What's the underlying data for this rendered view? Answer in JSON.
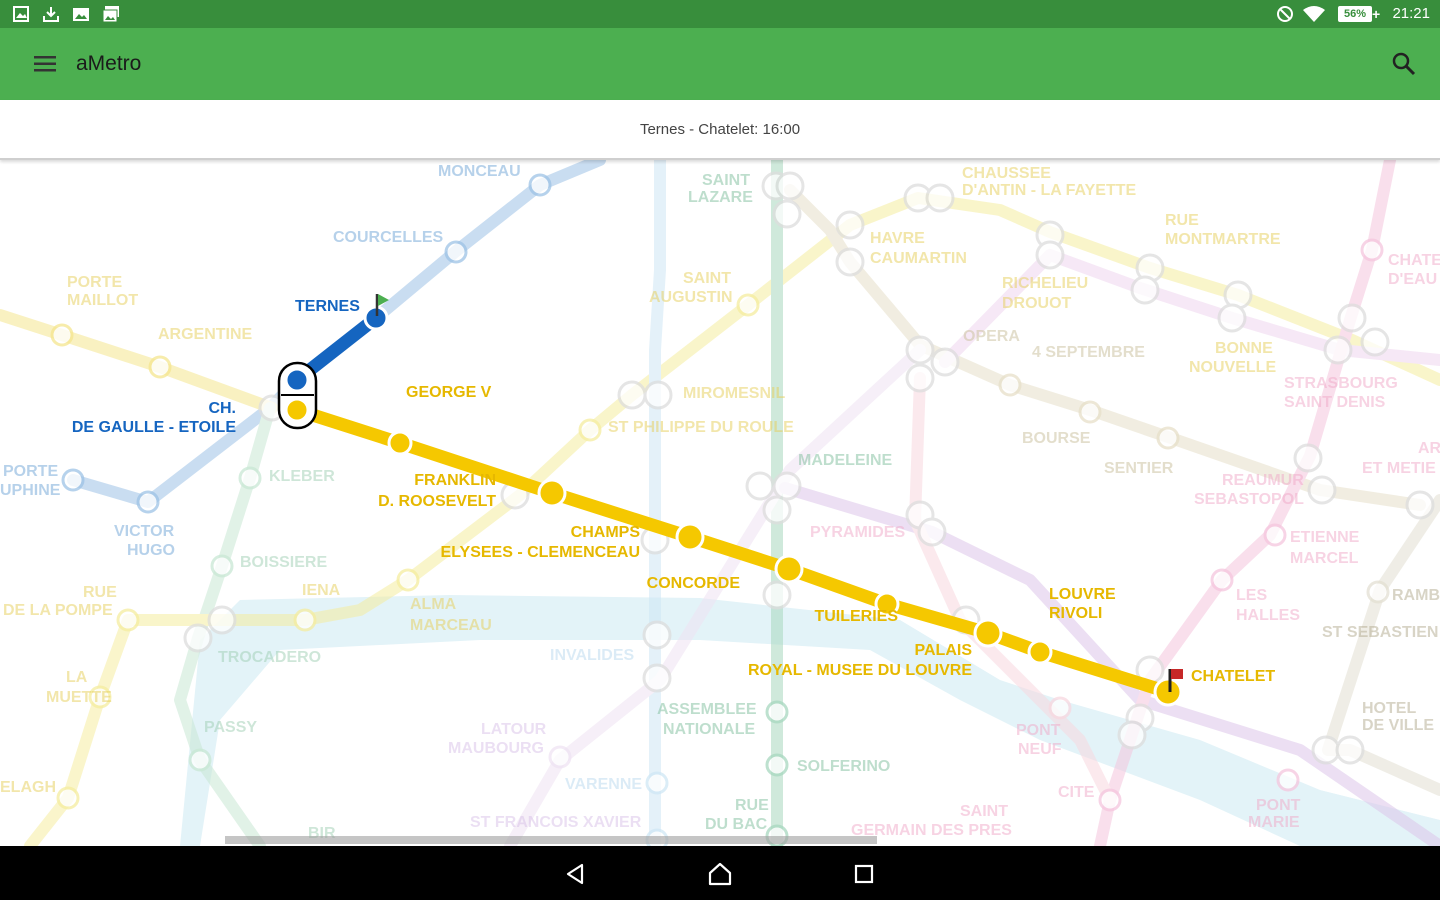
{
  "status_bar": {
    "time": "21:21",
    "battery": "56%",
    "left_icons": [
      "image-icon",
      "download-icon",
      "gallery-icon",
      "gallery-stack-icon"
    ],
    "right_icons": [
      "do-not-disturb-icon",
      "wifi-icon",
      "battery-icon"
    ]
  },
  "app_bar": {
    "title": "aMetro",
    "menu_icon": "hamburger-menu-icon",
    "search_icon": "search-icon",
    "color": "#4caf50"
  },
  "route": {
    "summary": "Ternes - Chatelet: 16:00",
    "start_flag": "green-flag-icon",
    "end_flag": "red-flag-icon"
  },
  "map": {
    "route_line_colors": {
      "line_2": "#1565c0",
      "line_1": "#f5c800"
    },
    "route_stations": {
      "ternes": "TERNES",
      "etoile_1": "CH.",
      "etoile_2": "DE GAULLE - ETOILE",
      "george_v": "GEORGE V",
      "franklin_1": "FRANKLIN",
      "franklin_2": "D. ROOSEVELT",
      "champs_1": "CHAMPS",
      "champs_2": "ELYSEES - CLEMENCEAU",
      "concorde": "CONCORDE",
      "tuileries": "TUILERIES",
      "palais_1": "PALAIS",
      "palais_2": "ROYAL - MUSEE DU LOUVRE",
      "louvre_1": "LOUVRE",
      "louvre_2": "RIVOLI",
      "chatelet": "CHATELET"
    },
    "other_stations": {
      "monceau": "MONCEAU",
      "courcelles": "COURCELLES",
      "porte_maillot_1": "PORTE",
      "porte_maillot_2": "MAILLOT",
      "argentine": "ARGENTINE",
      "porte_dauphine_1": "PORTE",
      "porte_dauphine_2": "UPHINE",
      "victor_1": "VICTOR",
      "victor_2": "HUGO",
      "kleber": "KLEBER",
      "boissiere": "BOISSIERE",
      "iena": "IENA",
      "rue_pompe_1": "RUE",
      "rue_pompe_2": "DE LA POMPE",
      "trocadero": "TROCADERO",
      "la_muette_1": "LA",
      "la_muette_2": "MUETTE",
      "passy": "PASSY",
      "ranelagh": "ELAGH",
      "bir": "BIR",
      "saint_lazare_1": "SAINT",
      "saint_lazare_2": "LAZARE",
      "saint_augustin_1": "SAINT",
      "saint_augustin_2": "AUGUSTIN",
      "miromesnil": "MIROMESNIL",
      "st_philippe": "ST PHILIPPE DU ROULE",
      "madeleine": "MADELEINE",
      "pyramides": "PYRAMIDES",
      "alma_1": "ALMA",
      "alma_2": "MARCEAU",
      "invalides": "INVALIDES",
      "assemblee_1": "ASSEMBLEE",
      "assemblee_2": "NATIONALE",
      "latour_1": "LATOUR",
      "latour_2": "MAUBOURG",
      "varenne": "VARENNE",
      "st_francois": "ST FRANCOIS XAVIER",
      "solferino": "SOLFERINO",
      "rue_du_bac_1": "RUE",
      "rue_du_bac_2": "DU BAC",
      "st_germain_1": "SAINT",
      "st_germain_2": "GERMAIN DES PRES",
      "chaussee_1": "CHAUSSEE",
      "chaussee_2": "D'ANTIN - LA FAYETTE",
      "havre_1": "HAVRE",
      "havre_2": "CAUMARTIN",
      "richelieu_1": "RICHELIEU",
      "richelieu_2": "DROUOT",
      "opera": "OPERA",
      "quatre_sept": "4 SEPTEMBRE",
      "bourse": "BOURSE",
      "sentier": "SENTIER",
      "rue_montmartre_1": "RUE",
      "rue_montmartre_2": "MONTMARTRE",
      "bonne_1": "BONNE",
      "bonne_2": "NOUVELLE",
      "strasbourg_1": "STRASBOURG",
      "strasbourg_2": "SAINT DENIS",
      "reaumur_1": "REAUMUR",
      "reaumur_2": "SEBASTOPOL",
      "etienne_1": "ETIENNE",
      "etienne_2": "MARCEL",
      "les_halles_1": "LES",
      "les_halles_2": "HALLES",
      "pont_neuf_1": "PONT",
      "pont_neuf_2": "NEUF",
      "cite": "CITE",
      "pont_marie_1": "PONT",
      "pont_marie_2": "MARIE",
      "hotel_ville_1": "HOTEL",
      "hotel_ville_2": "DE VILLE",
      "st_sebastien": "ST SEBASTIEN",
      "rambuteau": "RAMB",
      "arts_1": "AR",
      "arts_2": "ET METIE",
      "chateau_1": "CHATE",
      "chateau_2": "D'EAU"
    }
  },
  "nav_bar": {
    "back_icon": "back-triangle-icon",
    "home_icon": "home-icon",
    "recents_icon": "recents-square-icon"
  }
}
